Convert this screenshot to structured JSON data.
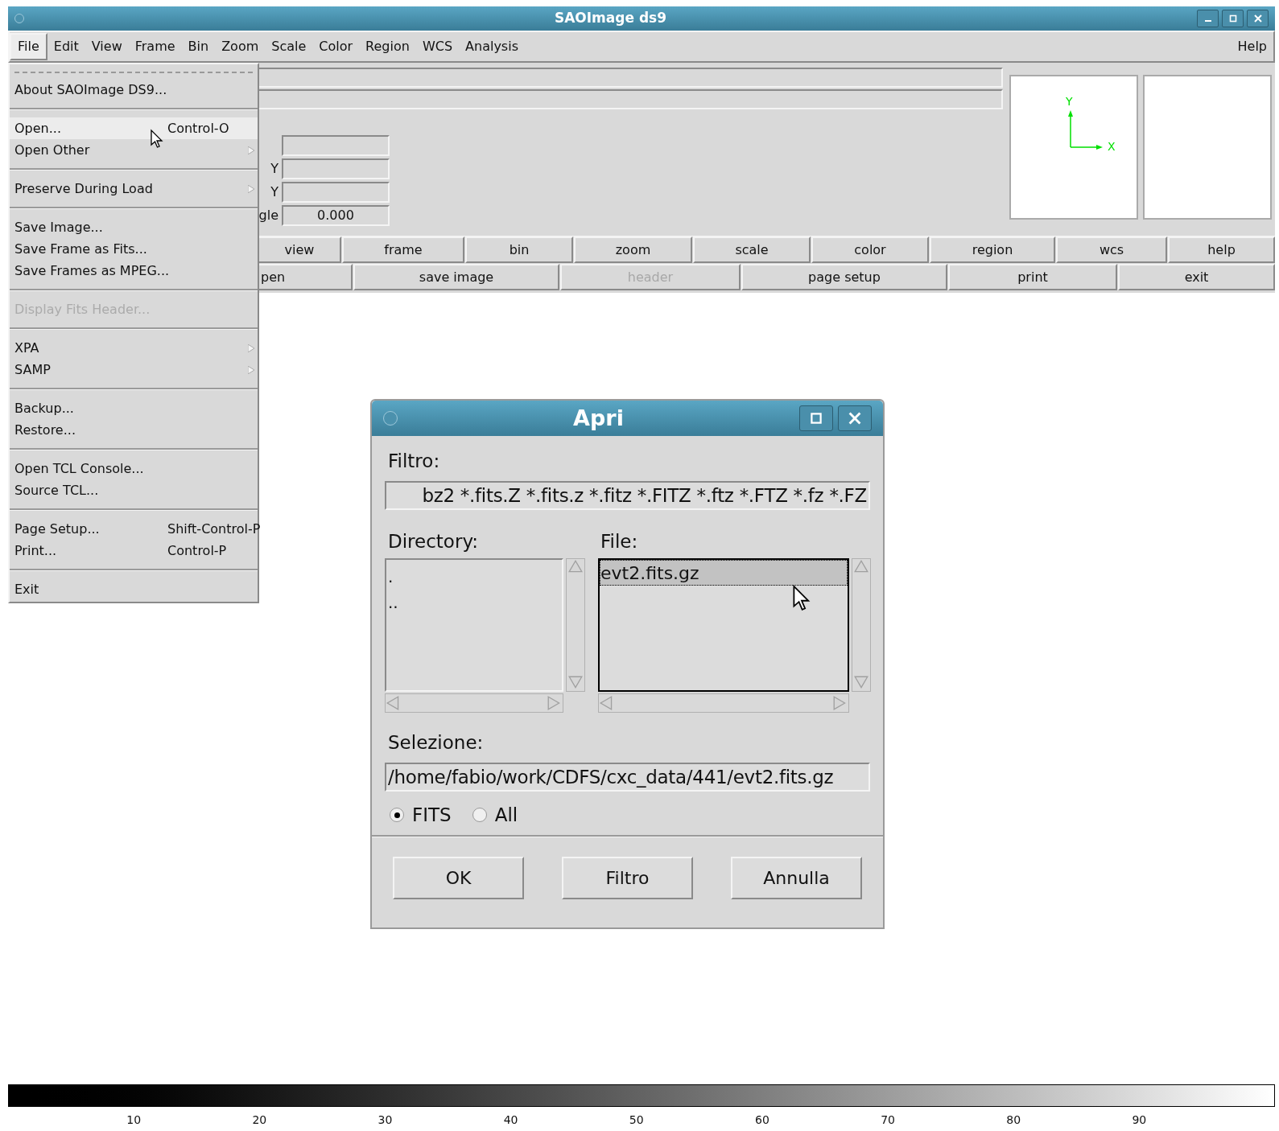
{
  "window": {
    "title": "SAOImage ds9"
  },
  "menubar": {
    "items": [
      {
        "label": "File",
        "selected": true
      },
      {
        "label": "Edit",
        "selected": false
      },
      {
        "label": "View",
        "selected": false
      },
      {
        "label": "Frame",
        "selected": false
      },
      {
        "label": "Bin",
        "selected": false
      },
      {
        "label": "Zoom",
        "selected": false
      },
      {
        "label": "Scale",
        "selected": false
      },
      {
        "label": "Color",
        "selected": false
      },
      {
        "label": "Region",
        "selected": false
      },
      {
        "label": "WCS",
        "selected": false
      },
      {
        "label": "Analysis",
        "selected": false
      }
    ],
    "help": "Help"
  },
  "file_menu": {
    "items": [
      {
        "kind": "tearoff"
      },
      {
        "kind": "item",
        "label": "About SAOImage DS9...",
        "selected": false,
        "disabled": false
      },
      {
        "kind": "separator"
      },
      {
        "kind": "item",
        "label": "Open...",
        "shortcut": "Control-O",
        "selected": true,
        "disabled": false
      },
      {
        "kind": "submenu",
        "label": "Open Other",
        "selected": false,
        "disabled": false
      },
      {
        "kind": "separator"
      },
      {
        "kind": "submenu",
        "label": "Preserve During Load",
        "selected": false,
        "disabled": false
      },
      {
        "kind": "separator"
      },
      {
        "kind": "item",
        "label": "Save Image...",
        "selected": false,
        "disabled": false
      },
      {
        "kind": "item",
        "label": "Save Frame as Fits...",
        "selected": false,
        "disabled": false
      },
      {
        "kind": "item",
        "label": "Save Frames as MPEG...",
        "selected": false,
        "disabled": false
      },
      {
        "kind": "separator"
      },
      {
        "kind": "item",
        "label": "Display Fits Header...",
        "selected": false,
        "disabled": true
      },
      {
        "kind": "separator"
      },
      {
        "kind": "submenu",
        "label": "XPA",
        "selected": false,
        "disabled": false
      },
      {
        "kind": "submenu",
        "label": "SAMP",
        "selected": false,
        "disabled": false
      },
      {
        "kind": "separator"
      },
      {
        "kind": "item",
        "label": "Backup...",
        "selected": false,
        "disabled": false
      },
      {
        "kind": "item",
        "label": "Restore...",
        "selected": false,
        "disabled": false
      },
      {
        "kind": "separator"
      },
      {
        "kind": "item",
        "label": "Open TCL Console...",
        "selected": false,
        "disabled": false
      },
      {
        "kind": "item",
        "label": "Source TCL...",
        "selected": false,
        "disabled": false
      },
      {
        "kind": "separator"
      },
      {
        "kind": "item",
        "label": "Page Setup...",
        "shortcut": "Shift-Control-P",
        "selected": false,
        "disabled": false
      },
      {
        "kind": "item",
        "label": "Print...",
        "shortcut": "Control-P",
        "selected": false,
        "disabled": false
      },
      {
        "kind": "separator"
      },
      {
        "kind": "item",
        "label": "Exit",
        "selected": false,
        "disabled": false
      }
    ]
  },
  "info_panel": {
    "fields": [
      {
        "label": "Y"
      },
      {
        "label": "Y"
      },
      {
        "label": "gle",
        "value": "0.000"
      }
    ]
  },
  "panner": {
    "y_label": "Y",
    "x_label": "X"
  },
  "view_buttons": {
    "buttons": [
      {
        "label": "view",
        "disabled": false
      },
      {
        "label": "frame",
        "disabled": false
      },
      {
        "label": "bin",
        "disabled": false
      },
      {
        "label": "zoom",
        "disabled": false
      },
      {
        "label": "scale",
        "disabled": false
      },
      {
        "label": "color",
        "disabled": false
      },
      {
        "label": "region",
        "disabled": false
      },
      {
        "label": "wcs",
        "disabled": false
      },
      {
        "label": "help",
        "disabled": false
      }
    ]
  },
  "command_buttons": {
    "buttons": [
      {
        "label": "pen",
        "disabled": false
      },
      {
        "label": "save image",
        "disabled": false
      },
      {
        "label": "header",
        "disabled": true
      },
      {
        "label": "page setup",
        "disabled": false
      },
      {
        "label": "print",
        "disabled": false
      },
      {
        "label": "exit",
        "disabled": false
      }
    ]
  },
  "colorbar": {
    "ticks": [
      "10",
      "20",
      "30",
      "40",
      "50",
      "60",
      "70",
      "80",
      "90"
    ]
  },
  "dialog": {
    "title": "Apri",
    "filter_label": "Filtro:",
    "filter_value": "bz2 *.fits.Z *.fits.z *.fitz *.FITZ *.ftz *.FTZ *.fz *.FZ",
    "directory_label": "Directory:",
    "directories": [
      {
        "name": ".",
        "selected": false
      },
      {
        "name": "..",
        "selected": false
      }
    ],
    "file_label": "File:",
    "files": [
      {
        "name": "evt2.fits.gz",
        "selected": true
      }
    ],
    "selection_label": "Selezione:",
    "selection_value": "/home/fabio/work/CDFS/cxc_data/441/evt2.fits.gz",
    "types": [
      {
        "label": "FITS",
        "selected": true
      },
      {
        "label": "All",
        "selected": false
      }
    ],
    "buttons": [
      "OK",
      "Filtro",
      "Annulla"
    ]
  }
}
